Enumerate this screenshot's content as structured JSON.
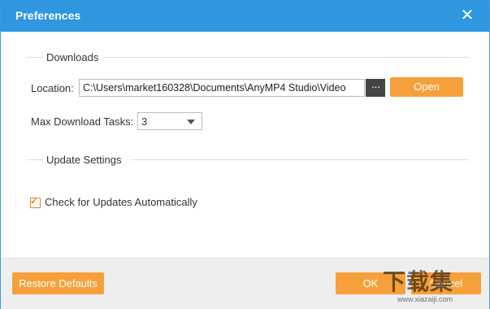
{
  "window": {
    "title": "Preferences"
  },
  "downloads": {
    "section_title": "Downloads",
    "location_label": "Location:",
    "location_value": "C:\\Users\\market160328\\Documents\\AnyMP4 Studio\\Video",
    "browse_label": "···",
    "open_label": "Open",
    "max_tasks_label": "Max Download Tasks:",
    "max_tasks_value": "3"
  },
  "update": {
    "section_title": "Update Settings",
    "auto_check_label": "Check for Updates Automatically",
    "auto_check_checked": true
  },
  "footer": {
    "restore_label": "Restore Defaults",
    "ok_label": "OK",
    "cancel_label": "Cancel"
  },
  "watermark": {
    "text": "下载集",
    "sub": "www.xiazaiji.com"
  },
  "colors": {
    "titlebar": "#2f97e0",
    "accent": "#f5a03a",
    "footer": "#eeeeee"
  }
}
